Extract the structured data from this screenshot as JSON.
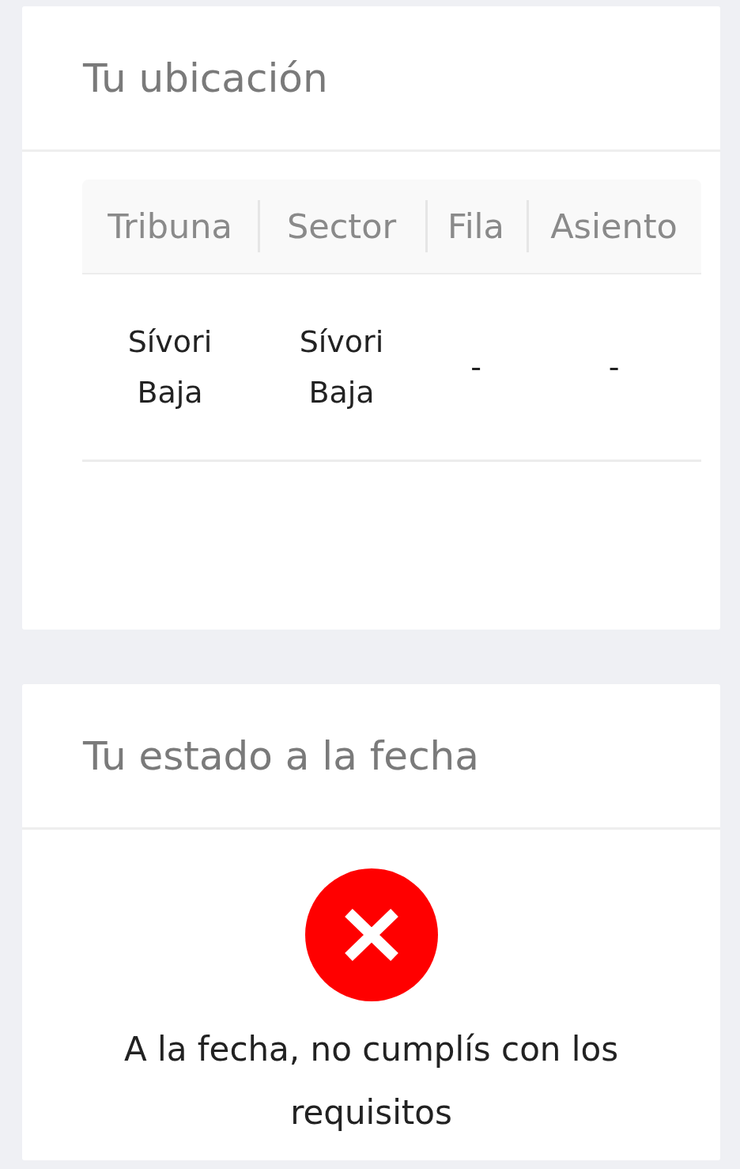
{
  "location": {
    "title": "Tu ubicación",
    "table": {
      "columns": [
        "Tribuna",
        "Sector",
        "Fila",
        "Asiento"
      ],
      "rows": [
        [
          "Sívori Baja",
          "Sívori Baja",
          "-",
          "-"
        ]
      ]
    }
  },
  "status": {
    "title": "Tu estado a la fecha",
    "requirements_met": false,
    "message": "A la fecha, no cumplís con los requisitos"
  }
}
